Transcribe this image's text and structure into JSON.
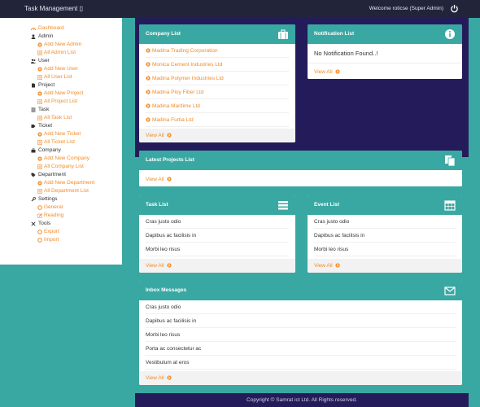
{
  "topbar": {
    "brand": "Task Management ▯",
    "welcome": "Welcome roticse (Super Admin)"
  },
  "sidebar": {
    "items": [
      {
        "kind": "top",
        "label": "Dashboard",
        "icon": "dashboard-icon",
        "highlight": true
      },
      {
        "kind": "top",
        "label": "Admin",
        "icon": "user-icon"
      },
      {
        "kind": "sub",
        "label": "Add New Admin",
        "icon": "plus-circle-icon"
      },
      {
        "kind": "sub",
        "label": "All Admin List",
        "icon": "list-icon"
      },
      {
        "kind": "top",
        "label": "User",
        "icon": "users-icon"
      },
      {
        "kind": "sub",
        "label": "Add New User",
        "icon": "plus-circle-icon"
      },
      {
        "kind": "sub",
        "label": "All User List",
        "icon": "list-icon"
      },
      {
        "kind": "top",
        "label": "Project",
        "icon": "file-icon"
      },
      {
        "kind": "sub",
        "label": "Add New Project",
        "icon": "plus-circle-icon"
      },
      {
        "kind": "sub",
        "label": "All Project List",
        "icon": "list-icon"
      },
      {
        "kind": "top",
        "label": "Task",
        "icon": "tasks-icon"
      },
      {
        "kind": "sub",
        "label": "All Task List",
        "icon": "list-icon"
      },
      {
        "kind": "top",
        "label": "Ticket",
        "icon": "ticket-icon"
      },
      {
        "kind": "sub",
        "label": "Add New Ticket",
        "icon": "plus-circle-icon"
      },
      {
        "kind": "sub",
        "label": "All Ticket List",
        "icon": "list-icon"
      },
      {
        "kind": "top",
        "label": "Company",
        "icon": "briefcase-icon"
      },
      {
        "kind": "sub",
        "label": "Add New Company",
        "icon": "plus-circle-icon"
      },
      {
        "kind": "sub",
        "label": "All Company List",
        "icon": "list-icon"
      },
      {
        "kind": "top",
        "label": "Department",
        "icon": "tag-icon"
      },
      {
        "kind": "sub",
        "label": "Add New Department",
        "icon": "plus-circle-icon"
      },
      {
        "kind": "sub",
        "label": "All Department List",
        "icon": "list-icon"
      },
      {
        "kind": "top",
        "label": "Settings",
        "icon": "wrench-icon"
      },
      {
        "kind": "sub",
        "label": "General",
        "icon": "circle-icon"
      },
      {
        "kind": "sub",
        "label": "Reading",
        "icon": "edit-icon"
      },
      {
        "kind": "top",
        "label": "Tools",
        "icon": "tools-icon"
      },
      {
        "kind": "sub",
        "label": "Export",
        "icon": "circle-icon"
      },
      {
        "kind": "sub",
        "label": "Import",
        "icon": "circle-icon"
      }
    ]
  },
  "company_list": {
    "title": "Company List",
    "items": [
      "Madina Trading Corporation",
      "Monica Cement Industries Ltd",
      "Madina Polymer Industries Ltd",
      "Madina Ploy Fiber Ltd",
      "Madina Maritime Ltd",
      "Madina Furtia Ltd"
    ],
    "view_all": "View All"
  },
  "notification_list": {
    "title": "Notification List",
    "message": "No Notification Found..!",
    "view_all": "View All"
  },
  "latest_projects": {
    "title": "Latest Projects List",
    "view_all": "View All"
  },
  "task_list": {
    "title": "Task List",
    "items": [
      "Cras justo odio",
      "Dapibus ac facilisis in",
      "Morbi leo risus"
    ],
    "view_all": "View All"
  },
  "event_list": {
    "title": "Event List",
    "items": [
      "Cras justo odio",
      "Dapibus ac facilisis in",
      "Morbi leo risus"
    ],
    "view_all": "View All"
  },
  "inbox_messages": {
    "title": "Inbox Messages",
    "items": [
      "Cras justo odio",
      "Dapibus ac facilisis in",
      "Morbi leo risus",
      "Porta ac consectetur ac",
      "Vestibulum at eros"
    ],
    "view_all": "View All"
  },
  "footer": {
    "text": "Copyright © Samrat ict Ltd. All Rights reserved."
  },
  "colors": {
    "teal": "#3aa8a2",
    "navy": "#241c5a",
    "topbar": "#22243a",
    "accent_orange": "#f08c28"
  }
}
